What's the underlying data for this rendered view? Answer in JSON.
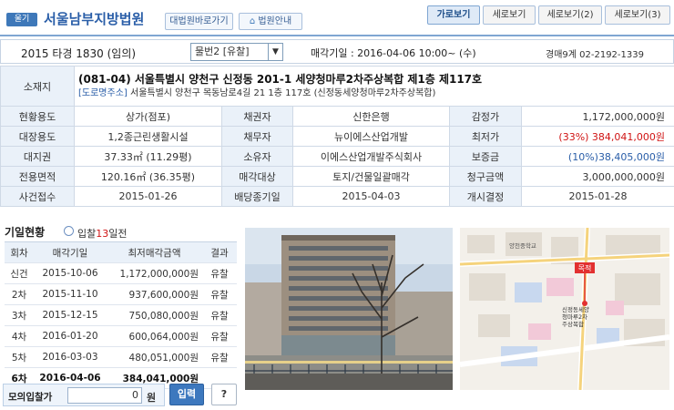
{
  "header": {
    "badge": "울기",
    "court": "서울남부지방법원",
    "direct_btn": "대법원바로가기",
    "info_btn": "법원안내"
  },
  "tabs": [
    "가로보기",
    "세로보기",
    "세로보기(2)",
    "세로보기(3)"
  ],
  "case": {
    "number": "2015 타경 1830 (임의)",
    "item_select": "물번2 [유찰]",
    "sale_date": "매각기일 : 2016-04-06 10:00~ (수)",
    "department": "경매9계 02-2192-1339"
  },
  "location": {
    "label": "소재지",
    "address": "(081-04) 서울특별시 양천구 신정동 201-1 세양청마루2차주상복합 제1층 제117호",
    "road_tag": "[도로명주소]",
    "road_address": "서울특별시 양천구 목동남로4길 21 1층 117호 (신정동세양청마루2차주상복합)"
  },
  "info_rows": [
    [
      "현황용도",
      "상가(점포)",
      "채권자",
      "신한은행",
      "감정가",
      "1,172,000,000원"
    ],
    [
      "대장용도",
      "1,2종근린생활시설",
      "채무자",
      "뉴이에스산업개발",
      "최저가",
      "(33%) 384,041,000원"
    ],
    [
      "대지권",
      "37.33㎡ (11.29평)",
      "소유자",
      "이에스산업개발주식회사",
      "보증금",
      "(10%)38,405,000원"
    ],
    [
      "전용면적",
      "120.16㎡ (36.35평)",
      "매각대상",
      "토지/건물일괄매각",
      "청구금액",
      "3,000,000,000원"
    ],
    [
      "사건접수",
      "2015-01-26",
      "배당종기일",
      "2015-04-03",
      "개시결정",
      "2015-01-28"
    ]
  ],
  "history": {
    "title": "기일현황",
    "sub_prefix": "입찰",
    "sub_days": "13",
    "sub_suffix": "일전",
    "columns": [
      "회차",
      "매각기일",
      "최저매각금액",
      "결과"
    ],
    "rows": [
      [
        "신건",
        "2015-10-06",
        "1,172,000,000원",
        "유찰"
      ],
      [
        "2차",
        "2015-11-10",
        "937,600,000원",
        "유찰"
      ],
      [
        "3차",
        "2015-12-15",
        "750,080,000원",
        "유찰"
      ],
      [
        "4차",
        "2016-01-20",
        "600,064,000원",
        "유찰"
      ],
      [
        "5차",
        "2016-03-03",
        "480,051,000원",
        "유찰"
      ],
      [
        "6차",
        "2016-04-06",
        "384,041,000원",
        ""
      ]
    ]
  },
  "bid": {
    "label": "모의입찰가",
    "value": "0",
    "unit": "원",
    "button": "입력",
    "help": "?"
  },
  "map": {
    "marker": "목적",
    "labels": [
      "양천중학교",
      "신정동세양",
      "청마루2차",
      "주상복합"
    ]
  }
}
